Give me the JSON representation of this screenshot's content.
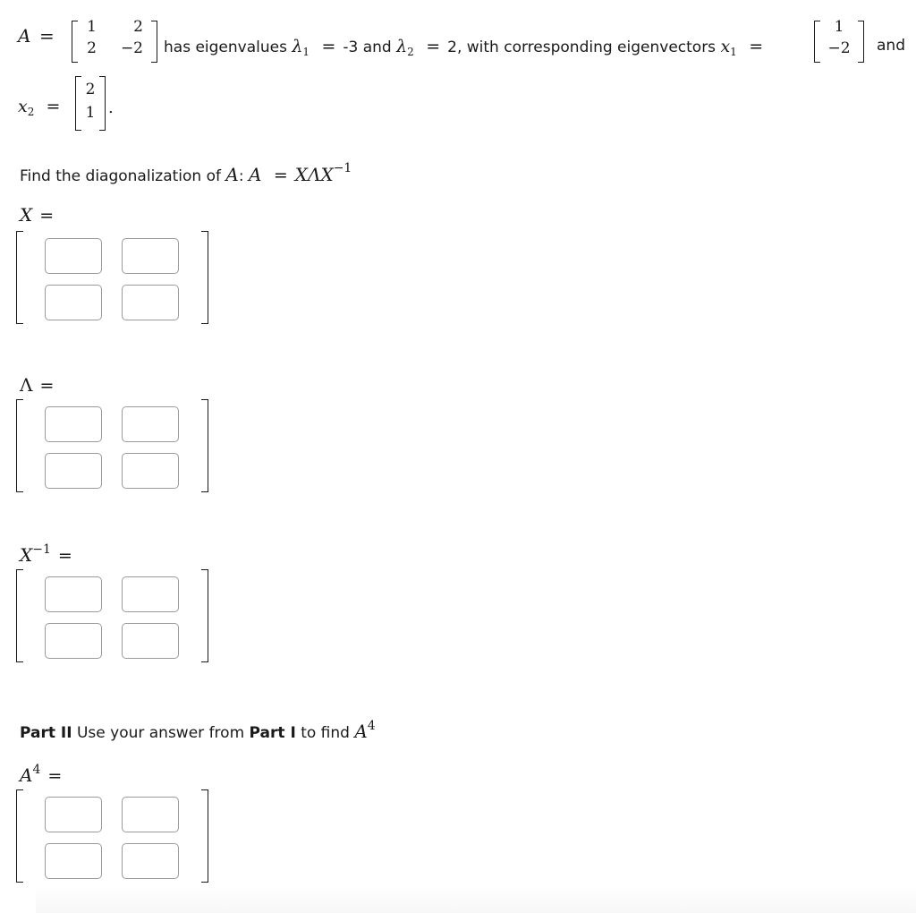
{
  "problem": {
    "matrix_A": {
      "name": "A",
      "rows": [
        [
          "1",
          "2"
        ],
        [
          "2",
          "−2"
        ]
      ]
    },
    "text_has_eigenvalues": "has eigenvalues",
    "lambda1_symbol": "λ",
    "lambda1_sub": "1",
    "lambda1_value": "-3",
    "and_word": "and",
    "lambda2_symbol": "λ",
    "lambda2_sub": "2",
    "lambda2_value": "2, with corresponding eigenvectors",
    "x1_symbol": "x",
    "x1_sub": "1",
    "x1_vector": [
      "1",
      "−2"
    ],
    "and_word_2": "and",
    "x2_symbol": "x",
    "x2_sub": "2",
    "x2_vector": [
      "2",
      "1"
    ],
    "period": ".",
    "equals": "="
  },
  "part1": {
    "prompt_text": "Find the diagonalization of",
    "prompt_A": "A",
    "prompt_colon": ":",
    "prompt_formula_lhs": "A",
    "prompt_formula_rhs": "XΛX",
    "prompt_formula_sup": "−1"
  },
  "matrices": [
    {
      "id": "X",
      "label": "X",
      "label_sup": "",
      "cells": [
        [
          "",
          ""
        ],
        [
          "",
          ""
        ]
      ]
    },
    {
      "id": "Lambda",
      "label": "Λ",
      "label_sup": "",
      "cells": [
        [
          "",
          ""
        ],
        [
          "",
          ""
        ]
      ]
    },
    {
      "id": "X_inv",
      "label": "X",
      "label_sup": "−1",
      "cells": [
        [
          "",
          ""
        ],
        [
          "",
          ""
        ]
      ]
    },
    {
      "id": "A4",
      "label": "A",
      "label_sup": "4",
      "cells": [
        [
          "",
          ""
        ],
        [
          "",
          ""
        ]
      ]
    }
  ],
  "part2": {
    "bold1": "Part II",
    "text1": "Use your answer from",
    "bold2": "Part I",
    "text2": "to find",
    "A": "A",
    "sup": "4"
  }
}
